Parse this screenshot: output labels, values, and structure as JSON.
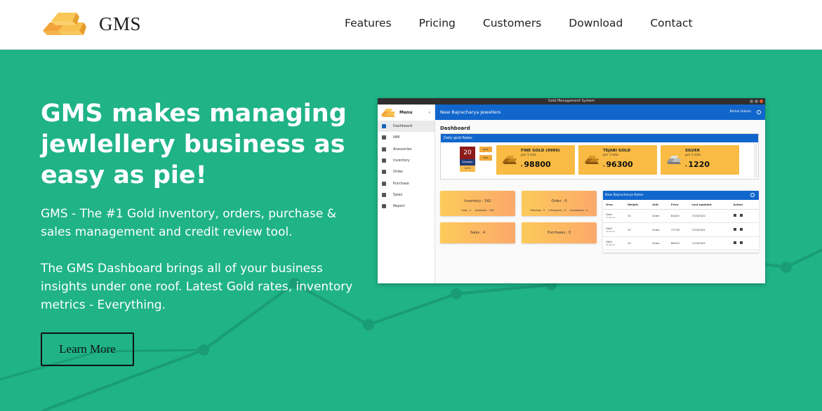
{
  "brand": {
    "name": "GMS",
    "logo": "gold-bars-logo"
  },
  "nav": {
    "links": [
      "Features",
      "Pricing",
      "Customers",
      "Download",
      "Contact"
    ]
  },
  "hero": {
    "title": "GMS makes managing jewlellery business as easy as pie!",
    "subtitle": "GMS - The #1 Gold inventory, orders, purchase & sales management and credit review tool.",
    "description": "The GMS Dashboard brings all of your business insights under one roof. Latest Gold rates, inventory metrics - Everything.",
    "cta": "Learn More"
  },
  "colors": {
    "background": "#1fb386",
    "navbar": "#ffffff",
    "accent_blue": "#1166cc",
    "card_gold": "#f9bb43"
  },
  "app": {
    "window_title": "Gold Management System",
    "sidebar": {
      "menu_label": "Menu",
      "items": [
        "Dashboard",
        "IAM",
        "Acessories",
        "Inventory",
        "Order",
        "Purchase",
        "Sales",
        "Report"
      ]
    },
    "topbar": {
      "shop_name": "New Bajracharya Jewellers",
      "user": "Bishal Udaish"
    },
    "dashboard_title": "Dashboard",
    "daily_rates": {
      "header": "Daily gold Rates",
      "date": {
        "day": "20",
        "month": "Shrawan",
        "year": "2079"
      },
      "unit_tags": [
        "gms",
        "tola"
      ],
      "cards": [
        {
          "name": "FINE GOLD (9999)",
          "per": "per 1 tola",
          "currency": "रु",
          "value": "98800"
        },
        {
          "name": "TEJABI GOLD",
          "per": "per 1 tola",
          "currency": "रु",
          "value": "96300"
        },
        {
          "name": "SILVER",
          "per": "per 1 tola",
          "currency": "रु",
          "value": "1220"
        }
      ]
    },
    "metrics": {
      "inventory": {
        "title": "Inventory : 342",
        "sold": "Sold : 4",
        "available": "Available : 338"
      },
      "order": {
        "title": "Order : 0",
        "pending": "Pending : 0",
        "inprogress": "InProgress : 0",
        "completed": "Completed : 0"
      },
      "sales": {
        "title": "Sales : 4"
      },
      "purchases": {
        "title": "Purchases : 0"
      }
    },
    "rates_table": {
      "header": "New Bajracharya Rates",
      "columns": [
        "Ores",
        "Weight",
        "Unit",
        "Price",
        "Last updated",
        "Action"
      ],
      "rows": [
        {
          "ore": "Gold",
          "karat": "24 Karat",
          "weight": "10",
          "unit": "Gram",
          "price": "84420",
          "updated": "7/19/2022"
        },
        {
          "ore": "Gold",
          "karat": "22 Karat",
          "weight": "10",
          "unit": "Gram",
          "price": "72718",
          "updated": "7/19/2022"
        },
        {
          "ore": "Gold",
          "karat": "18 Karat",
          "weight": "10",
          "unit": "Gram",
          "price": "68415",
          "updated": "7/19/2022"
        }
      ]
    }
  }
}
